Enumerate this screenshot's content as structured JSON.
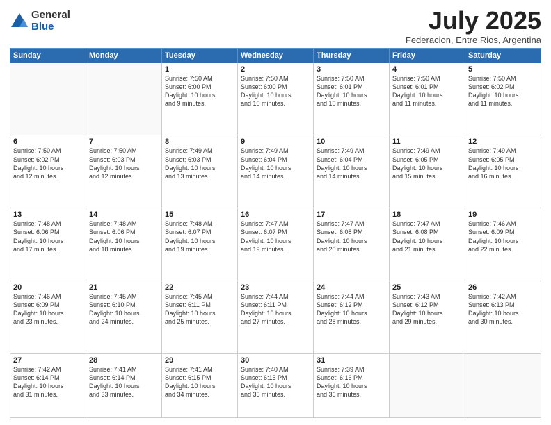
{
  "logo": {
    "general": "General",
    "blue": "Blue"
  },
  "header": {
    "month_year": "July 2025",
    "location": "Federacion, Entre Rios, Argentina"
  },
  "days_of_week": [
    "Sunday",
    "Monday",
    "Tuesday",
    "Wednesday",
    "Thursday",
    "Friday",
    "Saturday"
  ],
  "weeks": [
    [
      {
        "num": "",
        "info": ""
      },
      {
        "num": "",
        "info": ""
      },
      {
        "num": "1",
        "info": "Sunrise: 7:50 AM\nSunset: 6:00 PM\nDaylight: 10 hours\nand 9 minutes."
      },
      {
        "num": "2",
        "info": "Sunrise: 7:50 AM\nSunset: 6:00 PM\nDaylight: 10 hours\nand 10 minutes."
      },
      {
        "num": "3",
        "info": "Sunrise: 7:50 AM\nSunset: 6:01 PM\nDaylight: 10 hours\nand 10 minutes."
      },
      {
        "num": "4",
        "info": "Sunrise: 7:50 AM\nSunset: 6:01 PM\nDaylight: 10 hours\nand 11 minutes."
      },
      {
        "num": "5",
        "info": "Sunrise: 7:50 AM\nSunset: 6:02 PM\nDaylight: 10 hours\nand 11 minutes."
      }
    ],
    [
      {
        "num": "6",
        "info": "Sunrise: 7:50 AM\nSunset: 6:02 PM\nDaylight: 10 hours\nand 12 minutes."
      },
      {
        "num": "7",
        "info": "Sunrise: 7:50 AM\nSunset: 6:03 PM\nDaylight: 10 hours\nand 12 minutes."
      },
      {
        "num": "8",
        "info": "Sunrise: 7:49 AM\nSunset: 6:03 PM\nDaylight: 10 hours\nand 13 minutes."
      },
      {
        "num": "9",
        "info": "Sunrise: 7:49 AM\nSunset: 6:04 PM\nDaylight: 10 hours\nand 14 minutes."
      },
      {
        "num": "10",
        "info": "Sunrise: 7:49 AM\nSunset: 6:04 PM\nDaylight: 10 hours\nand 14 minutes."
      },
      {
        "num": "11",
        "info": "Sunrise: 7:49 AM\nSunset: 6:05 PM\nDaylight: 10 hours\nand 15 minutes."
      },
      {
        "num": "12",
        "info": "Sunrise: 7:49 AM\nSunset: 6:05 PM\nDaylight: 10 hours\nand 16 minutes."
      }
    ],
    [
      {
        "num": "13",
        "info": "Sunrise: 7:48 AM\nSunset: 6:06 PM\nDaylight: 10 hours\nand 17 minutes."
      },
      {
        "num": "14",
        "info": "Sunrise: 7:48 AM\nSunset: 6:06 PM\nDaylight: 10 hours\nand 18 minutes."
      },
      {
        "num": "15",
        "info": "Sunrise: 7:48 AM\nSunset: 6:07 PM\nDaylight: 10 hours\nand 19 minutes."
      },
      {
        "num": "16",
        "info": "Sunrise: 7:47 AM\nSunset: 6:07 PM\nDaylight: 10 hours\nand 19 minutes."
      },
      {
        "num": "17",
        "info": "Sunrise: 7:47 AM\nSunset: 6:08 PM\nDaylight: 10 hours\nand 20 minutes."
      },
      {
        "num": "18",
        "info": "Sunrise: 7:47 AM\nSunset: 6:08 PM\nDaylight: 10 hours\nand 21 minutes."
      },
      {
        "num": "19",
        "info": "Sunrise: 7:46 AM\nSunset: 6:09 PM\nDaylight: 10 hours\nand 22 minutes."
      }
    ],
    [
      {
        "num": "20",
        "info": "Sunrise: 7:46 AM\nSunset: 6:09 PM\nDaylight: 10 hours\nand 23 minutes."
      },
      {
        "num": "21",
        "info": "Sunrise: 7:45 AM\nSunset: 6:10 PM\nDaylight: 10 hours\nand 24 minutes."
      },
      {
        "num": "22",
        "info": "Sunrise: 7:45 AM\nSunset: 6:11 PM\nDaylight: 10 hours\nand 25 minutes."
      },
      {
        "num": "23",
        "info": "Sunrise: 7:44 AM\nSunset: 6:11 PM\nDaylight: 10 hours\nand 27 minutes."
      },
      {
        "num": "24",
        "info": "Sunrise: 7:44 AM\nSunset: 6:12 PM\nDaylight: 10 hours\nand 28 minutes."
      },
      {
        "num": "25",
        "info": "Sunrise: 7:43 AM\nSunset: 6:12 PM\nDaylight: 10 hours\nand 29 minutes."
      },
      {
        "num": "26",
        "info": "Sunrise: 7:42 AM\nSunset: 6:13 PM\nDaylight: 10 hours\nand 30 minutes."
      }
    ],
    [
      {
        "num": "27",
        "info": "Sunrise: 7:42 AM\nSunset: 6:14 PM\nDaylight: 10 hours\nand 31 minutes."
      },
      {
        "num": "28",
        "info": "Sunrise: 7:41 AM\nSunset: 6:14 PM\nDaylight: 10 hours\nand 33 minutes."
      },
      {
        "num": "29",
        "info": "Sunrise: 7:41 AM\nSunset: 6:15 PM\nDaylight: 10 hours\nand 34 minutes."
      },
      {
        "num": "30",
        "info": "Sunrise: 7:40 AM\nSunset: 6:15 PM\nDaylight: 10 hours\nand 35 minutes."
      },
      {
        "num": "31",
        "info": "Sunrise: 7:39 AM\nSunset: 6:16 PM\nDaylight: 10 hours\nand 36 minutes."
      },
      {
        "num": "",
        "info": ""
      },
      {
        "num": "",
        "info": ""
      }
    ]
  ]
}
